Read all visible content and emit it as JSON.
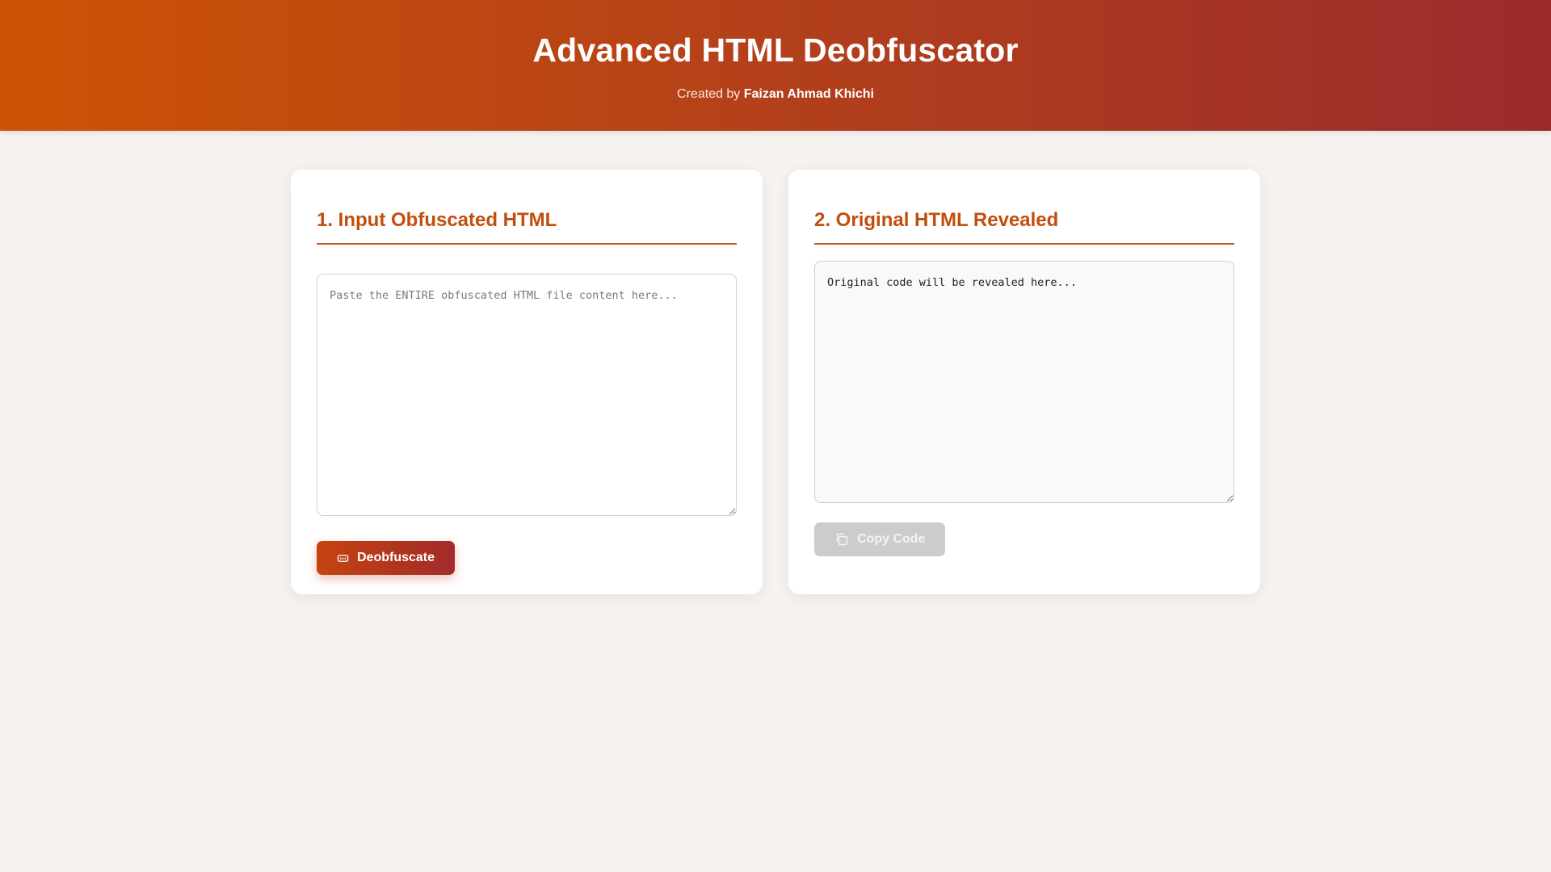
{
  "header": {
    "title": "Advanced HTML Deobfuscator",
    "credit_prefix": "Created by",
    "credit_author": "Faizan Ahmad Khichi"
  },
  "input_panel": {
    "heading": "1. Input Obfuscated HTML",
    "textarea_value": "",
    "textarea_placeholder": "Paste the ENTIRE obfuscated HTML file content here...",
    "button_label": "Deobfuscate",
    "button_icon": "code-icon"
  },
  "output_panel": {
    "heading": "2. Original HTML Revealed",
    "textarea_value": "Original code will be revealed here...",
    "button_label": "Copy Code",
    "button_icon": "copy-icon",
    "button_disabled": true
  },
  "colors": {
    "accent": "#c24e0b",
    "header_gradient_start": "#cd5305",
    "header_gradient_end": "#9c2a2d",
    "page_background": "#f6f2ef",
    "disabled_button": "#cccccc"
  }
}
